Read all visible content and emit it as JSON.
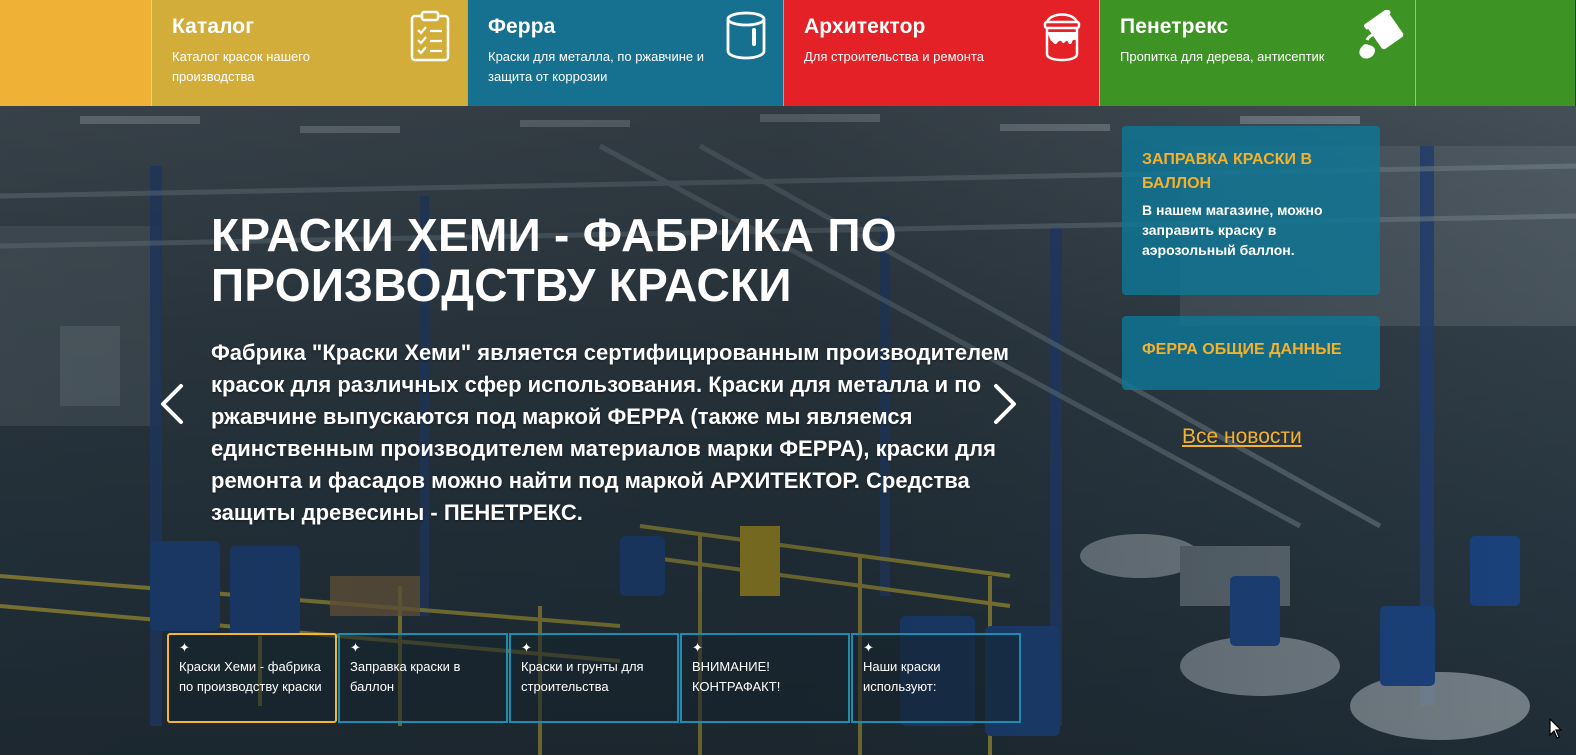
{
  "categories": [
    {
      "title": "Каталог",
      "subtitle": "Каталог красок нашего производства",
      "icon": "clipboard-checklist-icon",
      "color": "#d2ad3a"
    },
    {
      "title": "Ферра",
      "subtitle": "Краски для металла, по ржавчине и защита от коррозии",
      "icon": "paint-bucket-icon",
      "color": "#15718f"
    },
    {
      "title": "Архитектор",
      "subtitle": "Для строительства и ремонта",
      "icon": "paint-can-drip-icon",
      "color": "#e32126"
    },
    {
      "title": "Пенетрекс",
      "subtitle": "Пропитка для дерева, антисептик",
      "icon": "pouring-paint-icon",
      "color": "#3d9424"
    }
  ],
  "hero": {
    "headline": "КРАСКИ ХЕМИ - ФАБРИКА ПО ПРОИЗВОДСТВУ КРАСКИ",
    "text": "Фабрика \"Краски Хеми\" является сертифицированным производителем красок для различных сфер использования. Краски для металла и по ржавчине выпускаются под маркой ФЕРРА (также мы являемся единственным производителем материалов марки ФЕРРА), краски для ремонта и фасадов можно найти под маркой АРХИТЕКТОР. Средства защиты древесины - ПЕНЕТРЕКС."
  },
  "news": [
    {
      "title": "ЗАПРАВКА КРАСКИ В БАЛЛОН",
      "text": "В нашем магазине, можно заправить краску в аэрозольный баллон."
    },
    {
      "title": "ФЕРРА ОБЩИЕ ДАННЫЕ",
      "text": ""
    }
  ],
  "all_news_label": "Все новости",
  "slides": [
    {
      "label": "Краски Хеми - фабрика по производству краски",
      "active": true
    },
    {
      "label": "Заправка краски в баллон",
      "active": false
    },
    {
      "label": "Краски и грунты для строительства",
      "active": false
    },
    {
      "label": "ВНИМАНИЕ! КОНТРАФАКТ!",
      "active": false
    },
    {
      "label": "Наши краски используют:",
      "active": false
    }
  ],
  "colors": {
    "accent": "#f4b12c",
    "news_bg": "#0e7696",
    "brand_yellow": "#efb136",
    "brand_green": "#3d9424"
  }
}
